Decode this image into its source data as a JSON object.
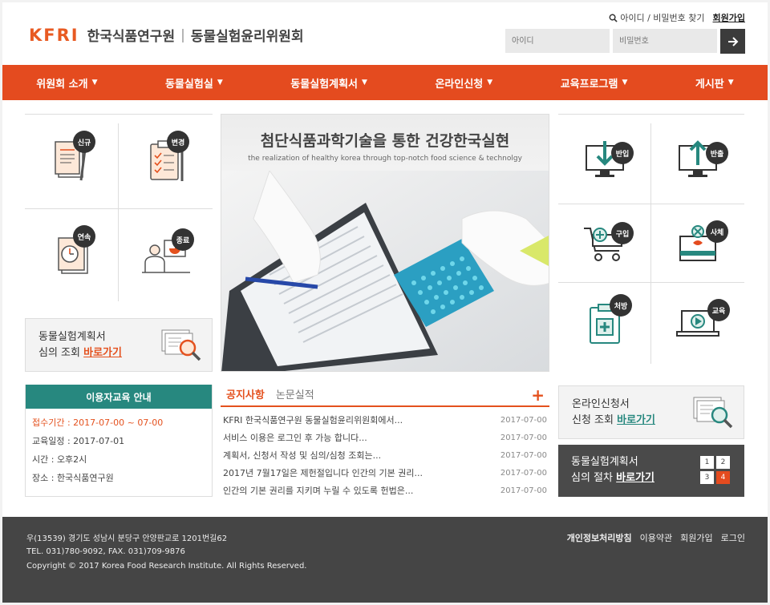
{
  "header": {
    "logo_mark": "KFRI",
    "org_name": "한국식품연구원",
    "divider": "|",
    "committee_name": "동물실험윤리위원회",
    "find_label": "아이디 / 비밀번호 찾기",
    "join_label": "회원가입",
    "id_placeholder": "아이디",
    "pw_placeholder": "비밀번호"
  },
  "nav": {
    "items": [
      {
        "label": "위원회 소개"
      },
      {
        "label": "동물실험실"
      },
      {
        "label": "동물실험계획서"
      },
      {
        "label": "온라인신청"
      },
      {
        "label": "교육프로그램"
      },
      {
        "label": "게시판"
      }
    ],
    "arrow": "▼"
  },
  "left_icons": [
    {
      "label": "신규",
      "icon": "new-document-icon"
    },
    {
      "label": "변경",
      "icon": "clipboard-checklist-icon"
    },
    {
      "label": "연속",
      "icon": "clock-document-icon"
    },
    {
      "label": "종료",
      "icon": "presenter-chart-icon"
    }
  ],
  "plan_review": {
    "line1": "동물실험계획서",
    "line2": "심의 조회",
    "link": "바로가기"
  },
  "hero": {
    "title": "첨단식품과학기술을 통한 건강한국실현",
    "subtitle": "the realization of healthy korea through top-notch food science & technolgy"
  },
  "right_icons": [
    {
      "label": "반입",
      "icon": "import-monitor-icon"
    },
    {
      "label": "반출",
      "icon": "export-monitor-icon"
    },
    {
      "label": "구입",
      "icon": "shopping-cart-icon"
    },
    {
      "label": "사체",
      "icon": "carcass-box-icon"
    },
    {
      "label": "처방",
      "icon": "prescription-clipboard-icon"
    },
    {
      "label": "교육",
      "icon": "laptop-play-icon"
    }
  ],
  "edu": {
    "title": "이용자교육 안내",
    "rows": [
      "접수기간 : 2017-07-00 ~ 07-00",
      "교육일정 : 2017-07-01",
      "시간 : 오후2시",
      "장소 : 한국식품연구원"
    ]
  },
  "board": {
    "tabs": [
      "공지사항",
      "논문실적"
    ],
    "more": "+",
    "posts": [
      {
        "title": "KFRI 한국식품연구원 동물실험윤리위원회에서...",
        "date": "2017-07-00"
      },
      {
        "title": "서비스 이용은 로그인 후 가능 합니다...",
        "date": "2017-07-00"
      },
      {
        "title": "계획서, 신청서 작성 및 심의/심청 조회는...",
        "date": "2017-07-00"
      },
      {
        "title": "2017년 7월17일은 제헌절입니다 인간의 기본 권리...",
        "date": "2017-07-00"
      },
      {
        "title": "인간의 기본 권리를 지키며 누릴 수 있도록 헌법은...",
        "date": "2017-07-00"
      }
    ]
  },
  "online_review": {
    "line1": "온라인신청서",
    "line2": "신청 조회",
    "link": "바로가기"
  },
  "procedure": {
    "line1": "동물실험계획서",
    "line2": "심의 절차",
    "link": "바로가기",
    "steps": [
      "1",
      "2",
      "3",
      "4"
    ]
  },
  "footer": {
    "address": "우(13539) 경기도 성남시 분당구 안양판교로 1201번길62",
    "tel": "TEL. 031)780-9092, FAX. 031)709-9876",
    "copyright": "Copyright © 2017 Korea Food Research Institute. All Rights Reserved.",
    "links": [
      "개인정보처리방침",
      "이용약관",
      "회원가입",
      "로그인"
    ]
  },
  "colors": {
    "accent": "#e44b1f",
    "teal": "#27887f",
    "dark": "#454545"
  }
}
